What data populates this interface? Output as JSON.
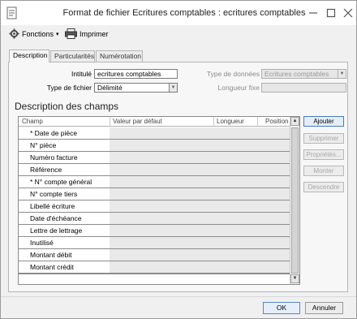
{
  "window": {
    "title": "Format de fichier Ecritures comptables : ecritures comptables"
  },
  "toolbar": {
    "fonctions_label": "Fonctions",
    "imprimer_label": "Imprimer"
  },
  "tabs": [
    {
      "label": "Description",
      "active": true
    },
    {
      "label": "Particularités",
      "active": false
    },
    {
      "label": "Numérotation",
      "active": false
    }
  ],
  "form": {
    "intitule_label": "Intitulé",
    "intitule_value": "ecritures comptables",
    "type_fichier_label": "Type de fichier",
    "type_fichier_value": "Délimité",
    "type_donnees_label": "Type de données",
    "type_donnees_value": "Ecritures comptables",
    "longueur_fixe_label": "Longueur fixe",
    "longueur_fixe_value": ""
  },
  "section_title": "Description des champs",
  "grid": {
    "columns": [
      "Champ",
      "Valeur par défaut",
      "Longueur",
      "Position"
    ],
    "rows": [
      "* Date de pièce",
      "N° pièce",
      "Numéro facture",
      "Référence",
      "* N° compte général",
      "N° compte tiers",
      "Libellé écriture",
      "Date d'échéance",
      "Lettre de lettrage",
      "Inutilisé",
      "Montant débit",
      "Montant crédit"
    ]
  },
  "side_buttons": {
    "ajouter": "Ajouter",
    "supprimer": "Supprimer",
    "proprietes": "Propriétés...",
    "monter": "Monter",
    "descendre": "Descendre"
  },
  "dialog_buttons": {
    "ok": "OK",
    "annuler": "Annuler"
  },
  "colors": {
    "accent_border": "#4a7ab8",
    "disabled_text": "#a8a8a8",
    "grid_shade": "#e9e9e9"
  }
}
